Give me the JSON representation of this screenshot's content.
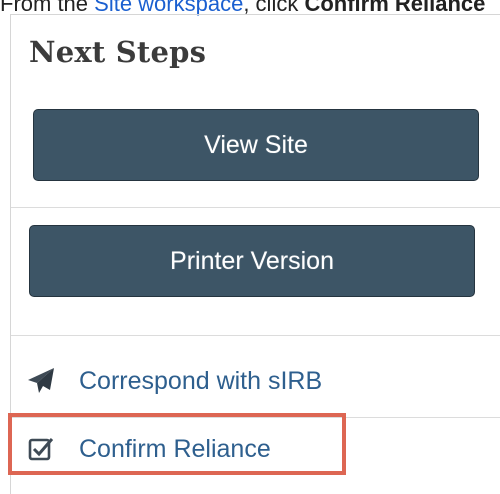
{
  "caption": {
    "prefix": "From the ",
    "link_text": "Site workspace",
    "middle": ", click ",
    "bold_text": "Confirm Reliance"
  },
  "panel": {
    "title": "Next Steps",
    "buttons": {
      "view_site": "View Site",
      "printer_version": "Printer Version"
    },
    "links": {
      "correspond": "Correspond with sIRB",
      "confirm": "Confirm Reliance"
    }
  },
  "colors": {
    "button_bg": "#3d5566",
    "link": "#2e5f8e",
    "highlight": "#dd6653"
  },
  "icons": {
    "correspond": "paper-plane-icon",
    "confirm": "checkbox-icon"
  }
}
